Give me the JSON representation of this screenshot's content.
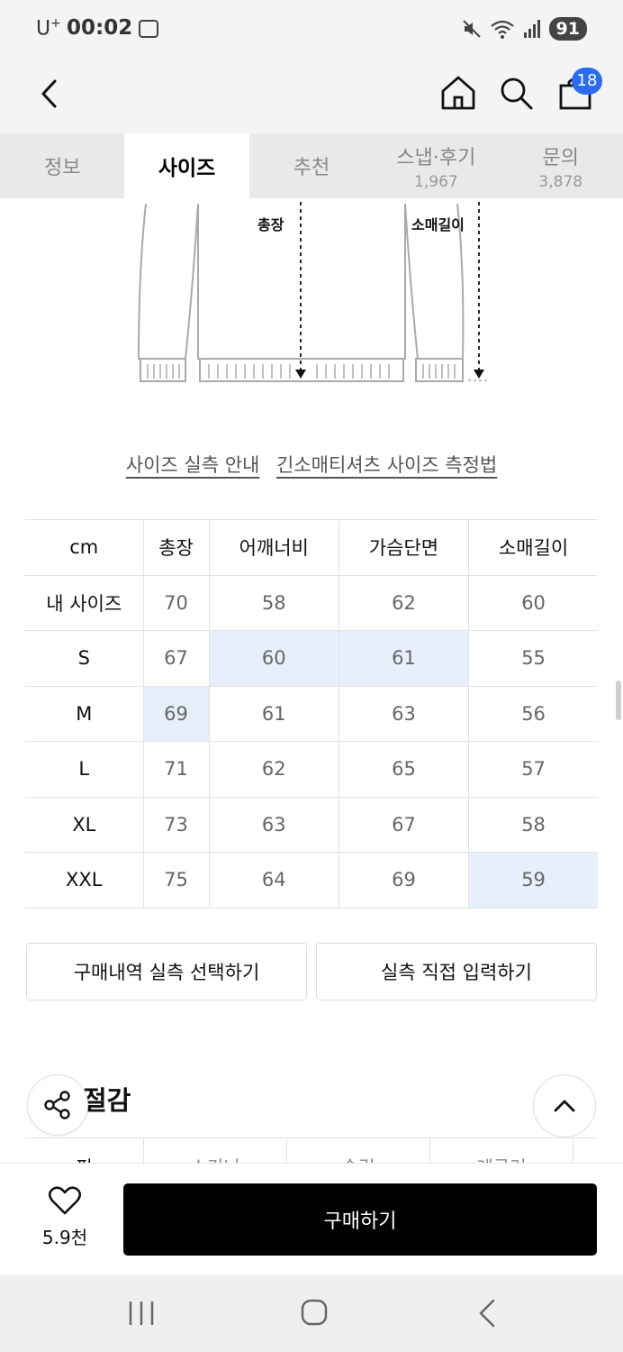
{
  "status_bar": {
    "carrier": "U",
    "carrier_sup": "+",
    "time": "00:02",
    "battery": "91"
  },
  "header": {
    "cart_badge": "18"
  },
  "tabs": [
    {
      "label": "정보",
      "count": ""
    },
    {
      "label": "사이즈",
      "count": ""
    },
    {
      "label": "추천",
      "count": ""
    },
    {
      "label": "스냅·후기",
      "count": "1,967"
    },
    {
      "label": "문의",
      "count": "3,878"
    }
  ],
  "diagram": {
    "label_length": "총장",
    "label_sleeve": "소매길이"
  },
  "links": {
    "size_guide": "사이즈 실측 안내",
    "measure_method": "긴소매티셔츠 사이즈 측정법"
  },
  "size_table": {
    "headers": [
      "cm",
      "총장",
      "어깨너비",
      "가슴단면",
      "소매길이"
    ],
    "rows": [
      {
        "size": "내 사이즈",
        "values": [
          "70",
          "58",
          "62",
          "60"
        ]
      },
      {
        "size": "S",
        "values": [
          "67",
          "60",
          "61",
          "55"
        ]
      },
      {
        "size": "M",
        "values": [
          "69",
          "61",
          "63",
          "56"
        ]
      },
      {
        "size": "L",
        "values": [
          "71",
          "62",
          "65",
          "57"
        ]
      },
      {
        "size": "XL",
        "values": [
          "73",
          "63",
          "67",
          "58"
        ]
      },
      {
        "size": "XXL",
        "values": [
          "75",
          "64",
          "69",
          "59"
        ]
      }
    ],
    "highlight_color": "#e7eefc"
  },
  "buttons": {
    "purchase_history": "구매내역 실측 선택하기",
    "direct_input": "실측 직접 입력하기"
  },
  "section": {
    "title": "절감",
    "cutoff_cols": [
      "핏",
      "스키니",
      "슬림",
      "레귤러"
    ]
  },
  "bottom_bar": {
    "like_count": "5.9천",
    "buy_label": "구매하기"
  },
  "colors": {
    "accent_badge": "#2a6bef",
    "buy_button": "#000000"
  }
}
